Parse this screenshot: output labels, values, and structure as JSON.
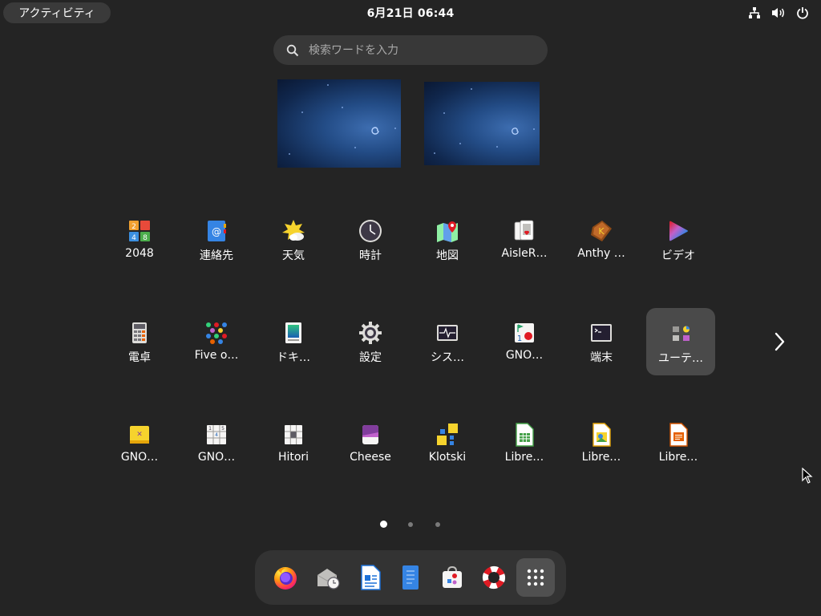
{
  "topbar": {
    "activities_label": "アクティビティ",
    "clock": "6月21日  06:44",
    "tray_icons": [
      "network-icon",
      "volume-icon",
      "power-icon"
    ]
  },
  "search": {
    "placeholder": "検索ワードを入力"
  },
  "workspaces": {
    "count": 2
  },
  "app_grid": {
    "rows": [
      [
        {
          "label": "2048",
          "icon": "2048-icon"
        },
        {
          "label": "連絡先",
          "icon": "contacts-icon"
        },
        {
          "label": "天気",
          "icon": "weather-icon"
        },
        {
          "label": "時計",
          "icon": "clock-icon"
        },
        {
          "label": "地図",
          "icon": "maps-icon"
        },
        {
          "label": "AisleR…",
          "icon": "cards-icon"
        },
        {
          "label": "Anthy …",
          "icon": "anthy-icon"
        },
        {
          "label": "ビデオ",
          "icon": "video-icon"
        }
      ],
      [
        {
          "label": "電卓",
          "icon": "calculator-icon"
        },
        {
          "label": "Five o…",
          "icon": "five-or-more-icon"
        },
        {
          "label": "ドキ…",
          "icon": "document-viewer-icon"
        },
        {
          "label": "設定",
          "icon": "settings-icon"
        },
        {
          "label": "シス…",
          "icon": "system-monitor-icon"
        },
        {
          "label": "GNO…",
          "icon": "mines-icon"
        },
        {
          "label": "端末",
          "icon": "terminal-icon"
        },
        {
          "label": "ユーテ…",
          "icon": "utilities-folder-icon"
        }
      ],
      [
        {
          "label": "GNO…",
          "icon": "mahjongg-icon"
        },
        {
          "label": "GNO…",
          "icon": "sudoku-icon"
        },
        {
          "label": "Hitori",
          "icon": "hitori-icon"
        },
        {
          "label": "Cheese",
          "icon": "cheese-icon"
        },
        {
          "label": "Klotski",
          "icon": "klotski-icon"
        },
        {
          "label": "Libre…",
          "icon": "libreoffice-calc-icon"
        },
        {
          "label": "Libre…",
          "icon": "libreoffice-draw-icon"
        },
        {
          "label": "Libre…",
          "icon": "libreoffice-impress-icon"
        }
      ]
    ],
    "highlighted": "ユーテ…"
  },
  "pagination": {
    "pages": 3,
    "current": 1
  },
  "dash": {
    "items": [
      "firefox-icon",
      "evolution-icon",
      "libreoffice-writer-icon",
      "text-editor-icon",
      "software-icon",
      "help-icon",
      "show-apps-icon"
    ],
    "selected": "show-apps-icon"
  },
  "colors": {
    "background": "#242424",
    "panel": "#333333",
    "highlight": "#4a4a4a"
  }
}
